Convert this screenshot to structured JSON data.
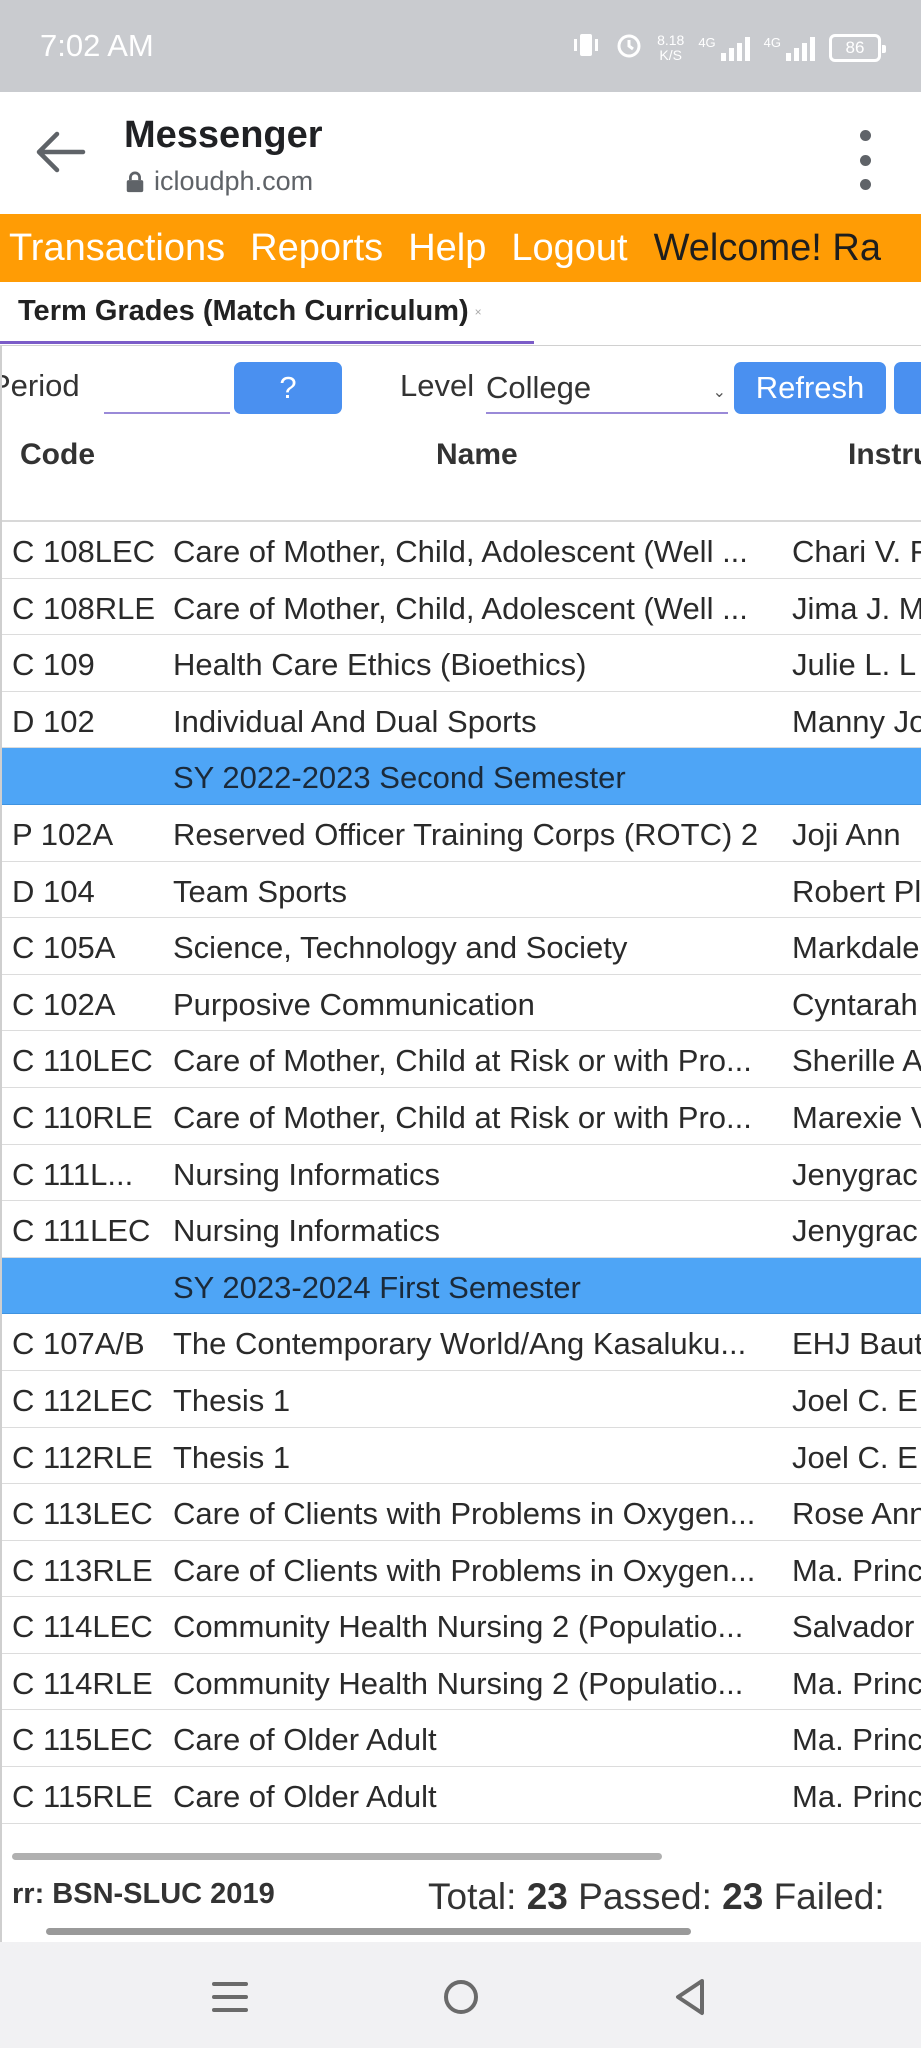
{
  "status": {
    "time": "7:02 AM",
    "speed": "8.18\nK/S",
    "network1": "4G",
    "network2": "4G",
    "battery": "86"
  },
  "appbar": {
    "title": "Messenger",
    "url": "icloudph.com"
  },
  "nav": {
    "items": [
      "Transactions",
      "Reports",
      "Help",
      "Logout"
    ],
    "welcome": "Welcome! Ra"
  },
  "tab": {
    "label": "Term Grades (Match Curriculum)",
    "close": "×"
  },
  "filters": {
    "period_label": "Period",
    "period_value": "",
    "lookup_button": "?",
    "level_label": "Level",
    "level_value": "College",
    "refresh_button": "Refresh"
  },
  "table": {
    "headers": {
      "code": "Code",
      "name": "Name",
      "instructor": "Instru"
    },
    "rows": [
      {
        "code": "C 108LEC",
        "name": "Care of Mother, Child, Adolescent (Well ...",
        "instructor": "Chari V. F"
      },
      {
        "code": "C 108RLE",
        "name": "Care of Mother, Child, Adolescent (Well ...",
        "instructor": "Jima J. M"
      },
      {
        "code": "C 109",
        "name": "Health Care Ethics (Bioethics)",
        "instructor": "Julie L. L"
      },
      {
        "code": "D 102",
        "name": "Individual And Dual Sports",
        "instructor": "Manny Jo"
      },
      {
        "group": true,
        "name": "SY 2022-2023 Second Semester"
      },
      {
        "code": "P 102A",
        "name": "Reserved Officer Training Corps (ROTC) 2",
        "instructor": "Joji Ann"
      },
      {
        "code": "D 104",
        "name": "Team Sports",
        "instructor": "Robert Pl"
      },
      {
        "code": "C 105A",
        "name": "Science, Technology and Society",
        "instructor": "Markdale"
      },
      {
        "code": "C 102A",
        "name": "Purposive Communication",
        "instructor": "Cyntarah"
      },
      {
        "code": "C 110LEC",
        "name": "Care of Mother, Child at Risk or with Pro...",
        "instructor": "Sherille A"
      },
      {
        "code": "C 110RLE",
        "name": "Care of Mother, Child at Risk or with Pro...",
        "instructor": "Marexie V"
      },
      {
        "code": "C 111L...",
        "name": "Nursing Informatics",
        "instructor": "Jenygrac"
      },
      {
        "code": "C 111LEC",
        "name": "Nursing Informatics",
        "instructor": "Jenygrac"
      },
      {
        "group": true,
        "name": "SY 2023-2024 First Semester"
      },
      {
        "code": "C 107A/B",
        "name": "The Contemporary World/Ang Kasaluku...",
        "instructor": "EHJ Baut"
      },
      {
        "code": "C 112LEC",
        "name": "Thesis 1",
        "instructor": "Joel C. E"
      },
      {
        "code": "C 112RLE",
        "name": "Thesis 1",
        "instructor": "Joel C. E"
      },
      {
        "code": "C 113LEC",
        "name": "Care of Clients with Problems in Oxygen...",
        "instructor": "Rose Ann"
      },
      {
        "code": "C 113RLE",
        "name": "Care of Clients with Problems in Oxygen...",
        "instructor": "Ma. Princ"
      },
      {
        "code": "C 114LEC",
        "name": "Community Health Nursing 2 (Populatio...",
        "instructor": "Salvador"
      },
      {
        "code": "C 114RLE",
        "name": "Community Health Nursing 2 (Populatio...",
        "instructor": "Ma. Princ"
      },
      {
        "code": "C 115LEC",
        "name": "Care of Older Adult",
        "instructor": "Ma. Princ"
      },
      {
        "code": "C 115RLE",
        "name": "Care of Older Adult",
        "instructor": "Ma. Princ"
      }
    ]
  },
  "footer": {
    "curriculum_label": "rr: ",
    "curriculum_value": "BSN-SLUC 2019",
    "total_label": "Total: ",
    "total_value": "23",
    "passed_label": " Passed: ",
    "passed_value": "23",
    "failed_label": " Failed:"
  },
  "icons": {
    "back": "arrow-left-icon",
    "more": "more-vert-icon",
    "lock": "lock-icon",
    "menu": "recent-apps-icon",
    "home": "home-icon",
    "sysback": "system-back-icon"
  }
}
